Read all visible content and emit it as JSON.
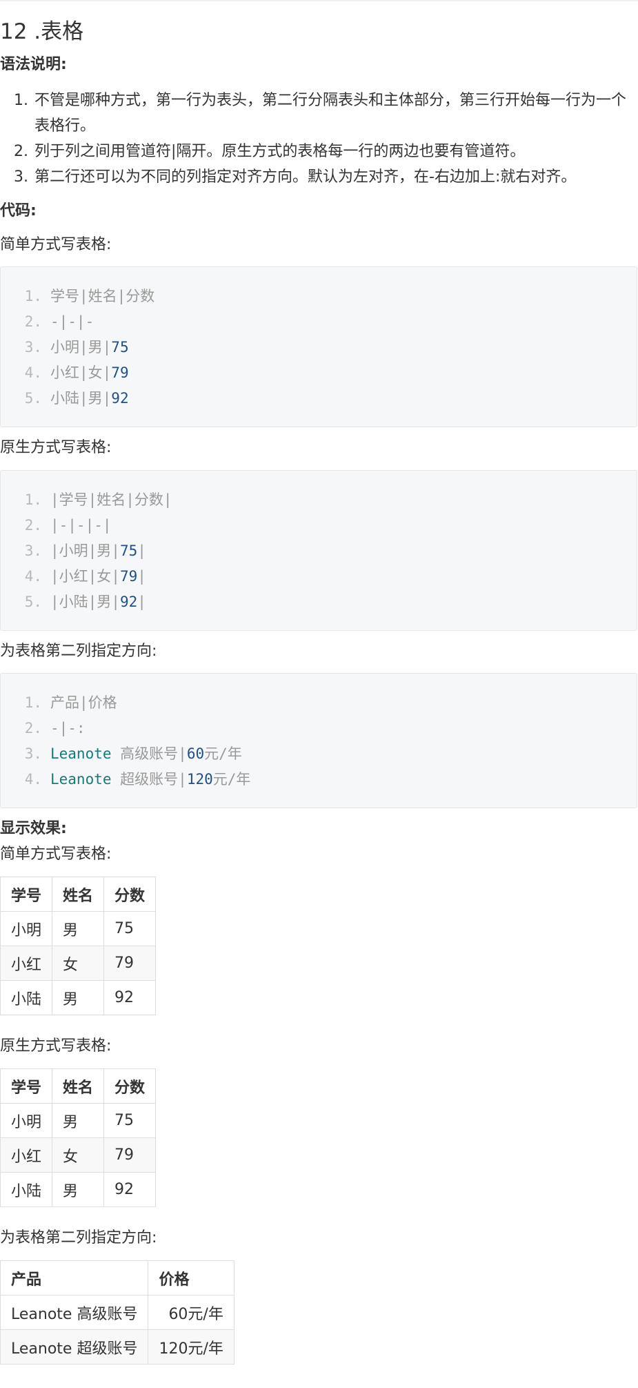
{
  "section": {
    "title": "12 .表格"
  },
  "syntax": {
    "label": "语法说明:",
    "rules": [
      "不管是哪种方式，第一行为表头，第二行分隔表头和主体部分，第三行开始每一行为一个表格行。",
      "列于列之间用管道符|隔开。原生方式的表格每一行的两边也要有管道符。",
      "第二行还可以为不同的列指定对齐方向。默认为左对齐，在-右边加上:就右对齐。"
    ]
  },
  "code": {
    "label": "代码:",
    "simple": {
      "caption": "简单方式写表格:",
      "lines": [
        {
          "num": "1.",
          "text": "学号|姓名|分数",
          "num_token": ""
        },
        {
          "num": "2.",
          "text": "-|-|-",
          "num_token": ""
        },
        {
          "num": "3.",
          "text": "小明|男|",
          "num_token": "75"
        },
        {
          "num": "4.",
          "text": "小红|女|",
          "num_token": "79"
        },
        {
          "num": "5.",
          "text": "小陆|男|",
          "num_token": "92"
        }
      ]
    },
    "native": {
      "caption": "原生方式写表格:",
      "lines": [
        {
          "num": "1.",
          "text": "|学号|姓名|分数|",
          "num_token": "",
          "tail": ""
        },
        {
          "num": "2.",
          "text": "|-|-|-|",
          "num_token": "",
          "tail": ""
        },
        {
          "num": "3.",
          "text": "|小明|男|",
          "num_token": "75",
          "tail": "|"
        },
        {
          "num": "4.",
          "text": "|小红|女|",
          "num_token": "79",
          "tail": "|"
        },
        {
          "num": "5.",
          "text": "|小陆|男|",
          "num_token": "92",
          "tail": "|"
        }
      ]
    },
    "align": {
      "caption": "为表格第二列指定方向:",
      "lines": [
        {
          "num": "1.",
          "kw": "",
          "text": "产品|价格",
          "num_token": "",
          "tail": ""
        },
        {
          "num": "2.",
          "kw": "",
          "text": "-|-:",
          "num_token": "",
          "tail": ""
        },
        {
          "num": "3.",
          "kw": "Leanote",
          "text": " 高级账号|",
          "num_token": "60",
          "tail": "元/年"
        },
        {
          "num": "4.",
          "kw": "Leanote",
          "text": " 超级账号|",
          "num_token": "120",
          "tail": "元/年"
        }
      ]
    }
  },
  "result": {
    "label": "显示效果:",
    "simple": {
      "caption": "简单方式写表格:",
      "headers": [
        "学号",
        "姓名",
        "分数"
      ],
      "rows": [
        [
          "小明",
          "男",
          "75"
        ],
        [
          "小红",
          "女",
          "79"
        ],
        [
          "小陆",
          "男",
          "92"
        ]
      ]
    },
    "native": {
      "caption": "原生方式写表格:",
      "headers": [
        "学号",
        "姓名",
        "分数"
      ],
      "rows": [
        [
          "小明",
          "男",
          "75"
        ],
        [
          "小红",
          "女",
          "79"
        ],
        [
          "小陆",
          "男",
          "92"
        ]
      ]
    },
    "align": {
      "caption": "为表格第二列指定方向:",
      "headers": [
        "产品",
        "价格"
      ],
      "rows": [
        [
          "Leanote 高级账号",
          "60元/年"
        ],
        [
          "Leanote 超级账号",
          "120元/年"
        ]
      ]
    }
  }
}
